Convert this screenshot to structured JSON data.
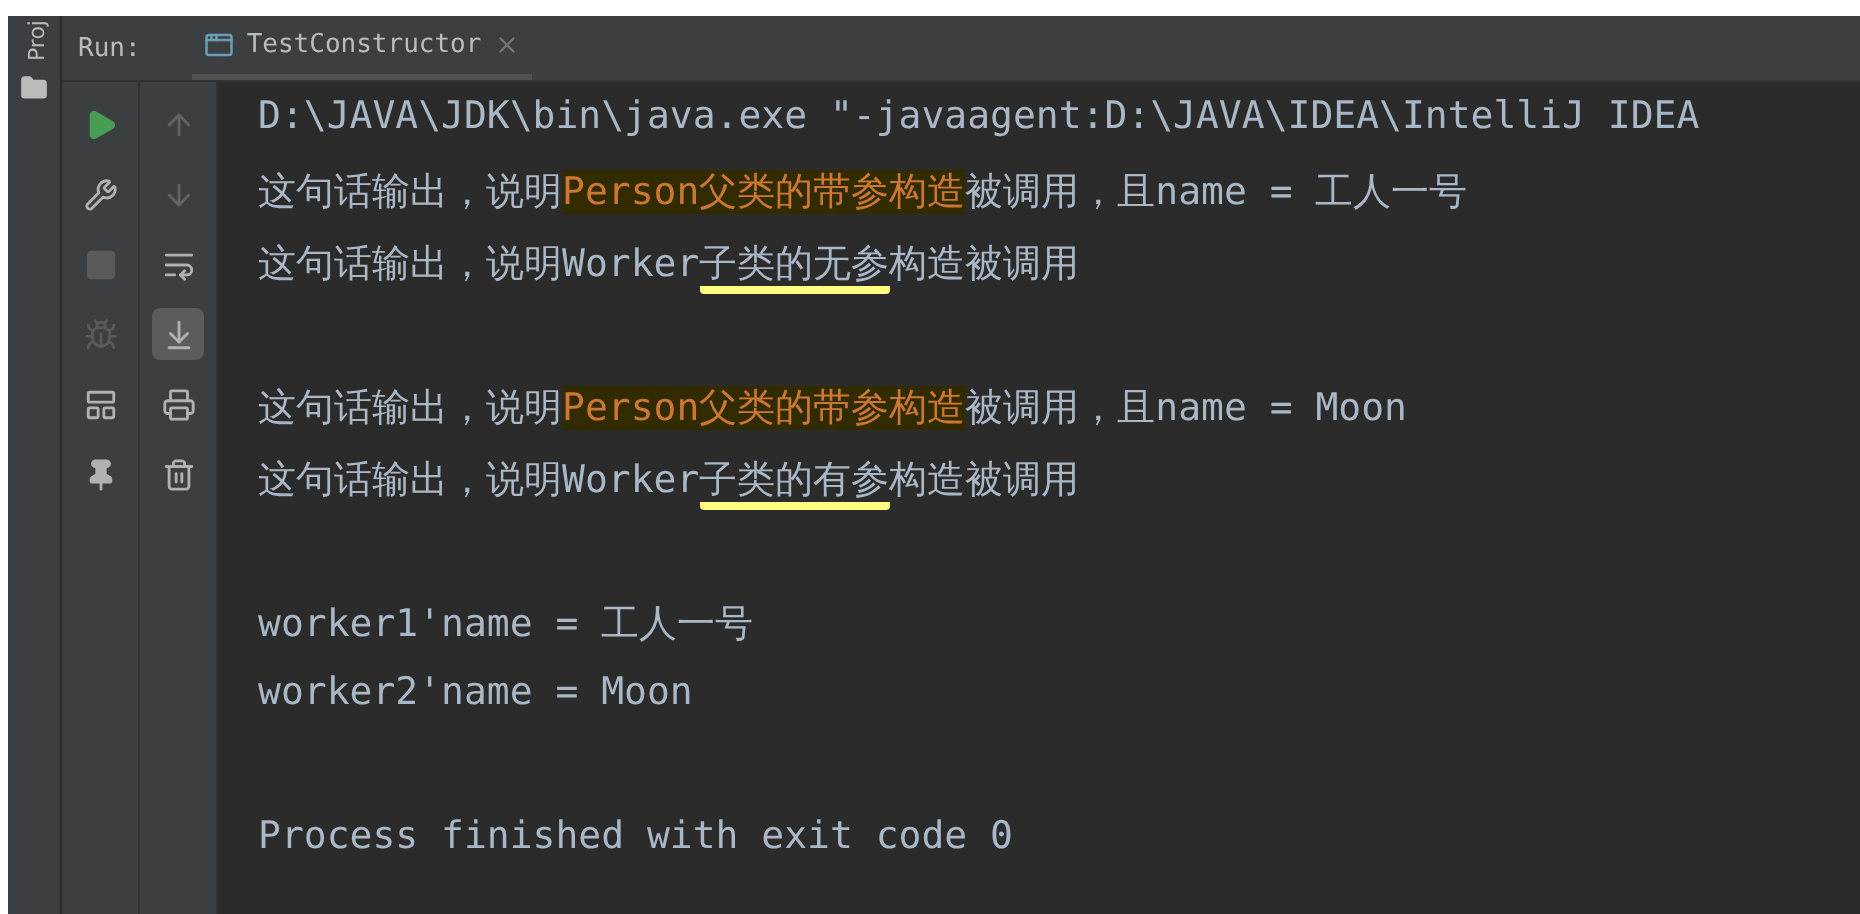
{
  "side_tab": {
    "label": "Proj"
  },
  "run_panel": {
    "label": "Run:",
    "tab": {
      "label": "TestConstructor",
      "selected": true
    }
  },
  "run_toolbar": [
    {
      "kind": "run",
      "disabled": false
    },
    {
      "kind": "wrench",
      "disabled": false
    },
    {
      "kind": "stop",
      "disabled": true
    },
    {
      "kind": "bug",
      "disabled": true
    },
    {
      "kind": "layout",
      "disabled": false
    },
    {
      "kind": "pin",
      "disabled": false
    }
  ],
  "console_toolbar": [
    {
      "kind": "up",
      "selected": false
    },
    {
      "kind": "down",
      "selected": false
    },
    {
      "kind": "wrap",
      "selected": false
    },
    {
      "kind": "scroll-end",
      "selected": true
    },
    {
      "kind": "print",
      "selected": false
    },
    {
      "kind": "trash",
      "selected": false
    }
  ],
  "console_lines": [
    {
      "kind": "text",
      "parts": [
        {
          "text": "D:\\JAVA\\JDK\\bin\\java.exe \"-javaagent:D:\\JAVA\\IDEA\\IntelliJ IDEA",
          "kind": "plain"
        }
      ]
    },
    {
      "kind": "text",
      "parts": [
        {
          "text": "这句话输出，说明",
          "kind": "plain"
        },
        {
          "text": "Person父类的带参构造",
          "kind": "highlight"
        },
        {
          "text": "被调用，且name = 工人一号",
          "kind": "plain"
        }
      ]
    },
    {
      "kind": "text",
      "parts": [
        {
          "text": "这句话输出，说明Worker",
          "kind": "plain"
        },
        {
          "text": "子类的无参",
          "kind": "underline"
        },
        {
          "text": "构造被调用",
          "kind": "plain"
        }
      ]
    },
    {
      "kind": "blank"
    },
    {
      "kind": "text",
      "parts": [
        {
          "text": "这句话输出，说明",
          "kind": "plain"
        },
        {
          "text": "Person父类的带参构造",
          "kind": "highlight"
        },
        {
          "text": "被调用，且name = Moon",
          "kind": "plain"
        }
      ]
    },
    {
      "kind": "text",
      "parts": [
        {
          "text": "这句话输出，说明Worker",
          "kind": "plain"
        },
        {
          "text": "子类的有参",
          "kind": "underline"
        },
        {
          "text": "构造被调用",
          "kind": "plain"
        }
      ]
    },
    {
      "kind": "blank"
    },
    {
      "kind": "text",
      "parts": [
        {
          "text": "worker1'name = 工人一号",
          "kind": "plain"
        }
      ]
    },
    {
      "kind": "text",
      "parts": [
        {
          "text": "worker2'name = Moon",
          "kind": "plain"
        }
      ]
    },
    {
      "kind": "blank"
    },
    {
      "kind": "text",
      "parts": [
        {
          "text": "Process finished with exit code 0",
          "kind": "plain"
        }
      ]
    }
  ]
}
